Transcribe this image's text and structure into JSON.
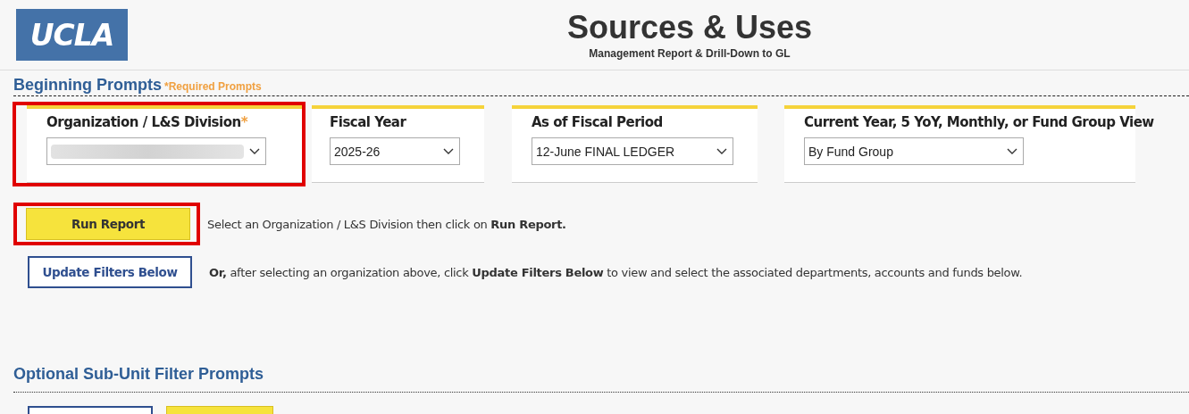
{
  "header": {
    "logo": "UCLA",
    "title": "Sources & Uses",
    "subtitle": "Management Report & Drill-Down to GL"
  },
  "beginning": {
    "heading": "Beginning Prompts",
    "required_note": "*Required Prompts",
    "prompts": [
      {
        "label": "Organization / L&S Division",
        "required": true,
        "redacted": true,
        "highlighted": true
      },
      {
        "label": "Fiscal Year",
        "required": false,
        "value": "2025-26",
        "redacted": false,
        "highlighted": false
      },
      {
        "label": "As of Fiscal Period",
        "required": false,
        "value": "12-June FINAL LEDGER",
        "redacted": false,
        "highlighted": false
      },
      {
        "label": "Current Year, 5 YoY, Monthly, or Fund Group View",
        "required": false,
        "value": "By Fund Group",
        "redacted": false,
        "highlighted": false
      }
    ],
    "required_mark": "*",
    "actions": [
      {
        "kind": "primary",
        "label": "Run Report",
        "highlighted": true,
        "note": "Select an Organization / L&S Division then click on **Run Report.**"
      },
      {
        "kind": "secondary",
        "label": "Update Filters Below",
        "highlighted": false,
        "note": "**Or,** after selecting an organization above, click **Update Filters Below** to view and select the associated departments, accounts and funds below."
      }
    ]
  },
  "optional": {
    "heading": "Optional Sub-Unit Filter Prompts",
    "buttons": [
      {
        "kind": "secondary"
      },
      {
        "kind": "primary"
      }
    ]
  }
}
